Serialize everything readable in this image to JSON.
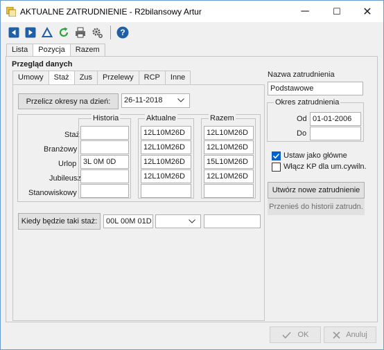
{
  "window": {
    "title": "AKTUALNE ZATRUDNIENIE - R2bilansowy Artur",
    "minimize_glyph": "─",
    "maximize_glyph": "☐",
    "close_glyph": "✕"
  },
  "toolbar": {
    "icons": [
      "first-icon",
      "last-icon",
      "up-arrow-icon",
      "refresh-icon",
      "printer-icon",
      "gear-icon",
      "help-icon"
    ],
    "help_glyph": "?"
  },
  "top_tabs": [
    "Lista",
    "Pozycja",
    "Razem"
  ],
  "panel_title": "Przegląd danych",
  "inner_tabs": [
    "Umowy",
    "Staż",
    "Zus",
    "Przelewy",
    "RCP",
    "Inne"
  ],
  "recalc": {
    "button_label": "Przelicz okresy na dzień:",
    "date_value": "26-11-2018"
  },
  "stats": {
    "row_labels": [
      "Staż",
      "Branżowy",
      "Urlop",
      "Jubileusz",
      "Stanowiskowy"
    ],
    "historia_title": "Historia",
    "historia_values": [
      "",
      "",
      "3L 0M 0D",
      "",
      ""
    ],
    "aktualne_title": "Aktualne",
    "aktualne_values": [
      "12L10M26D",
      "12L10M26D",
      "12L10M26D",
      "12L10M26D",
      ""
    ],
    "razem_title": "Razem",
    "razem_values": [
      "12L10M26D",
      "12L10M26D",
      "15L10M26D",
      "12L10M26D",
      ""
    ]
  },
  "kiedy": {
    "button_label": "Kiedy będzie taki staż:",
    "value": "00L 00M 01D",
    "select_value": "",
    "result_value": ""
  },
  "right": {
    "nazwa_label": "Nazwa zatrudnienia",
    "nazwa_value": "Podstawowe",
    "okres_title": "Okres zatrudnienia",
    "od_label": "Od",
    "od_value": "01-01-2006",
    "do_label": "Do",
    "do_value": "",
    "ustaw_label": "Ustaw jako główne",
    "ustaw_checked": true,
    "wlacz_label": "Włącz KP dla um.cywiln.",
    "wlacz_checked": false,
    "new_button_label": "Utwórz nowe zatrudnienie",
    "history_button_label": "Przenieś do historii zatrudn."
  },
  "footer": {
    "ok_label": "OK",
    "cancel_label": "Anuluj"
  }
}
